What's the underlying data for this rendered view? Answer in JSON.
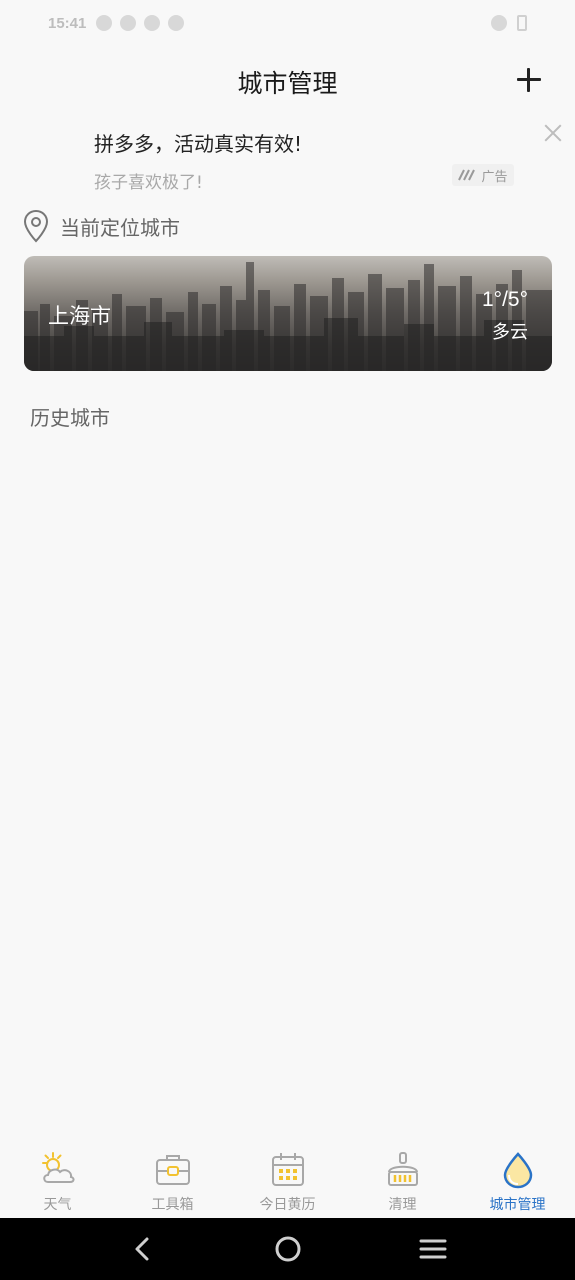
{
  "status_bar": {
    "time": "15:41"
  },
  "header": {
    "title": "城市管理",
    "add_label": "+"
  },
  "ad": {
    "title": "拼多多，活动真实有效!",
    "subtitle": "孩子喜欢极了!",
    "badge": "广告"
  },
  "current_location": {
    "label": "当前定位城市",
    "city": "上海市",
    "temperature": "1°/5°",
    "condition": "多云"
  },
  "history": {
    "label": "历史城市"
  },
  "tabs": [
    {
      "label": "天气",
      "icon": "sun-cloud-icon",
      "active": false
    },
    {
      "label": "工具箱",
      "icon": "toolbox-icon",
      "active": false
    },
    {
      "label": "今日黄历",
      "icon": "calendar-icon",
      "active": false
    },
    {
      "label": "清理",
      "icon": "broom-icon",
      "active": false
    },
    {
      "label": "城市管理",
      "icon": "water-drop-icon",
      "active": true
    }
  ],
  "colors": {
    "accent": "#2a73c7",
    "icon_yellow": "#f2c230",
    "icon_gray": "#a8a8a8"
  },
  "nav": {
    "back": "back-icon",
    "home": "home-icon",
    "menu": "menu-icon"
  }
}
